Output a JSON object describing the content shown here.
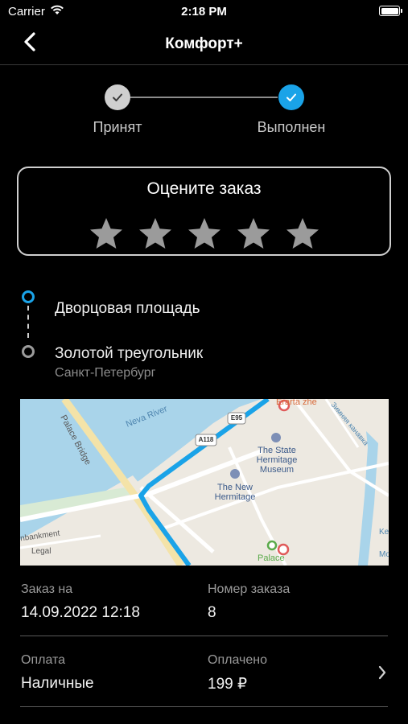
{
  "status_bar": {
    "carrier": "Carrier",
    "time": "2:18 PM"
  },
  "nav": {
    "title": "Комфорт+"
  },
  "progress": {
    "steps": [
      {
        "label": "Принят",
        "state": "done",
        "color": "#cfcfcf"
      },
      {
        "label": "Выполнен",
        "state": "current",
        "color": "#1aa3e8"
      }
    ]
  },
  "rating": {
    "title": "Оцените заказ",
    "max_stars": 5,
    "selected": 0,
    "star_color": "#9b9b9b"
  },
  "route": {
    "from": {
      "address": "Дворцовая площадь",
      "dot_color": "#1aa3e8"
    },
    "to": {
      "address": "Золотой треугольник",
      "city": "Санкт-Петербург",
      "dot_color": "#9b9b9b"
    }
  },
  "map": {
    "labels": {
      "palace_bridge": "Palace Bridge",
      "neva": "Neva River",
      "hermitage": "The State Hermitage Museum",
      "new_hermitage": "The New Hermitage",
      "palace": "Palace",
      "etazhe": "Erarta zhe",
      "kanavka": "Зимняя канавка",
      "embankment": "nbankment",
      "legal": "Legal",
      "shield1": "A118",
      "shield2": "E95",
      "edge1": "Ke",
      "edge2": "Mo"
    },
    "route_color": "#1aa3e8",
    "water_color": "#a9d4ea"
  },
  "details": {
    "order_date_label": "Заказ на",
    "order_date": "14.09.2022 12:18",
    "order_number_label": "Номер заказа",
    "order_number": "8",
    "payment_label": "Оплата",
    "payment": "Наличные",
    "paid_label": "Оплачено",
    "paid": "199 ₽"
  }
}
